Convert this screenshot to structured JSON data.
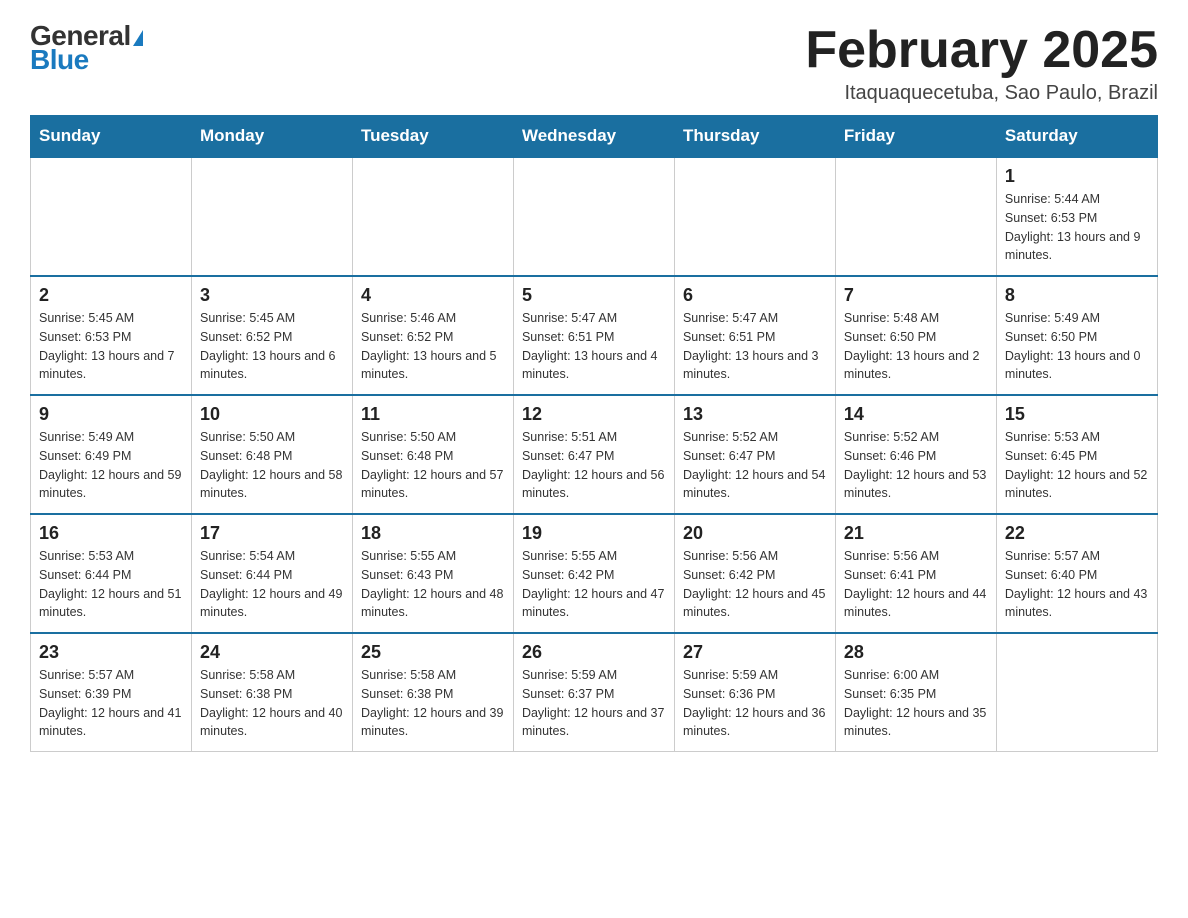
{
  "logo": {
    "general": "General",
    "triangle": "",
    "blue": "Blue"
  },
  "title": {
    "month_year": "February 2025",
    "location": "Itaquaquecetuba, Sao Paulo, Brazil"
  },
  "days_of_week": [
    "Sunday",
    "Monday",
    "Tuesday",
    "Wednesday",
    "Thursday",
    "Friday",
    "Saturday"
  ],
  "weeks": [
    {
      "days": [
        {
          "number": "",
          "info": ""
        },
        {
          "number": "",
          "info": ""
        },
        {
          "number": "",
          "info": ""
        },
        {
          "number": "",
          "info": ""
        },
        {
          "number": "",
          "info": ""
        },
        {
          "number": "",
          "info": ""
        },
        {
          "number": "1",
          "info": "Sunrise: 5:44 AM\nSunset: 6:53 PM\nDaylight: 13 hours and 9 minutes."
        }
      ]
    },
    {
      "days": [
        {
          "number": "2",
          "info": "Sunrise: 5:45 AM\nSunset: 6:53 PM\nDaylight: 13 hours and 7 minutes."
        },
        {
          "number": "3",
          "info": "Sunrise: 5:45 AM\nSunset: 6:52 PM\nDaylight: 13 hours and 6 minutes."
        },
        {
          "number": "4",
          "info": "Sunrise: 5:46 AM\nSunset: 6:52 PM\nDaylight: 13 hours and 5 minutes."
        },
        {
          "number": "5",
          "info": "Sunrise: 5:47 AM\nSunset: 6:51 PM\nDaylight: 13 hours and 4 minutes."
        },
        {
          "number": "6",
          "info": "Sunrise: 5:47 AM\nSunset: 6:51 PM\nDaylight: 13 hours and 3 minutes."
        },
        {
          "number": "7",
          "info": "Sunrise: 5:48 AM\nSunset: 6:50 PM\nDaylight: 13 hours and 2 minutes."
        },
        {
          "number": "8",
          "info": "Sunrise: 5:49 AM\nSunset: 6:50 PM\nDaylight: 13 hours and 0 minutes."
        }
      ]
    },
    {
      "days": [
        {
          "number": "9",
          "info": "Sunrise: 5:49 AM\nSunset: 6:49 PM\nDaylight: 12 hours and 59 minutes."
        },
        {
          "number": "10",
          "info": "Sunrise: 5:50 AM\nSunset: 6:48 PM\nDaylight: 12 hours and 58 minutes."
        },
        {
          "number": "11",
          "info": "Sunrise: 5:50 AM\nSunset: 6:48 PM\nDaylight: 12 hours and 57 minutes."
        },
        {
          "number": "12",
          "info": "Sunrise: 5:51 AM\nSunset: 6:47 PM\nDaylight: 12 hours and 56 minutes."
        },
        {
          "number": "13",
          "info": "Sunrise: 5:52 AM\nSunset: 6:47 PM\nDaylight: 12 hours and 54 minutes."
        },
        {
          "number": "14",
          "info": "Sunrise: 5:52 AM\nSunset: 6:46 PM\nDaylight: 12 hours and 53 minutes."
        },
        {
          "number": "15",
          "info": "Sunrise: 5:53 AM\nSunset: 6:45 PM\nDaylight: 12 hours and 52 minutes."
        }
      ]
    },
    {
      "days": [
        {
          "number": "16",
          "info": "Sunrise: 5:53 AM\nSunset: 6:44 PM\nDaylight: 12 hours and 51 minutes."
        },
        {
          "number": "17",
          "info": "Sunrise: 5:54 AM\nSunset: 6:44 PM\nDaylight: 12 hours and 49 minutes."
        },
        {
          "number": "18",
          "info": "Sunrise: 5:55 AM\nSunset: 6:43 PM\nDaylight: 12 hours and 48 minutes."
        },
        {
          "number": "19",
          "info": "Sunrise: 5:55 AM\nSunset: 6:42 PM\nDaylight: 12 hours and 47 minutes."
        },
        {
          "number": "20",
          "info": "Sunrise: 5:56 AM\nSunset: 6:42 PM\nDaylight: 12 hours and 45 minutes."
        },
        {
          "number": "21",
          "info": "Sunrise: 5:56 AM\nSunset: 6:41 PM\nDaylight: 12 hours and 44 minutes."
        },
        {
          "number": "22",
          "info": "Sunrise: 5:57 AM\nSunset: 6:40 PM\nDaylight: 12 hours and 43 minutes."
        }
      ]
    },
    {
      "days": [
        {
          "number": "23",
          "info": "Sunrise: 5:57 AM\nSunset: 6:39 PM\nDaylight: 12 hours and 41 minutes."
        },
        {
          "number": "24",
          "info": "Sunrise: 5:58 AM\nSunset: 6:38 PM\nDaylight: 12 hours and 40 minutes."
        },
        {
          "number": "25",
          "info": "Sunrise: 5:58 AM\nSunset: 6:38 PM\nDaylight: 12 hours and 39 minutes."
        },
        {
          "number": "26",
          "info": "Sunrise: 5:59 AM\nSunset: 6:37 PM\nDaylight: 12 hours and 37 minutes."
        },
        {
          "number": "27",
          "info": "Sunrise: 5:59 AM\nSunset: 6:36 PM\nDaylight: 12 hours and 36 minutes."
        },
        {
          "number": "28",
          "info": "Sunrise: 6:00 AM\nSunset: 6:35 PM\nDaylight: 12 hours and 35 minutes."
        },
        {
          "number": "",
          "info": ""
        }
      ]
    }
  ]
}
